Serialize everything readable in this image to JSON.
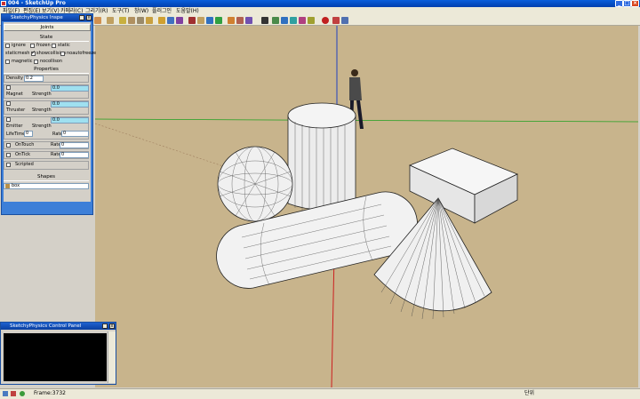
{
  "window": {
    "title": "004 - SketchUp Pro"
  },
  "menu": [
    "파일(F)",
    "편집(E)",
    "보기(V)",
    "카메라(C)",
    "그리기(R)",
    "도구(T)",
    "창(W)",
    "플러그인",
    "도움말(H)"
  ],
  "physics_panel": {
    "title": "SketchyPhysics Inspe",
    "joints_button": "Joints",
    "state_header": "State",
    "state_options": [
      {
        "label": "ignore",
        "checked": false
      },
      {
        "label": "frozen",
        "checked": false
      },
      {
        "label": "static",
        "checked": false
      },
      {
        "label": "staticmesh",
        "checked": false
      },
      {
        "label": "showcollision",
        "checked": true
      },
      {
        "label": "noautofreeze",
        "checked": false
      },
      {
        "label": "magnetic",
        "checked": false
      },
      {
        "label": "nocollison",
        "checked": false
      }
    ],
    "properties_header": "Properties",
    "density_label": "Density",
    "density_value": "0.2",
    "magnet_label": "Magnet",
    "magnet_strength_label": "Strength",
    "magnet_strength_value": "0.0",
    "thruster_label": "Thruster",
    "thruster_strength_label": "Strength",
    "thruster_strength_value": "0.0",
    "emitter_label": "Emitter",
    "emitter_strength_label": "Strength",
    "emitter_strength_value": "0.0",
    "lifetime_label": "LifeTime",
    "lifetime_value": "0",
    "rate_label": "Rate",
    "rate_value": "0",
    "ontouch_label": "OnTouch",
    "ontouch_rate_label": "Rate",
    "ontouch_rate_value": "0",
    "ontick_label": "OnTick",
    "ontick_rate_label": "Rate",
    "ontick_rate_value": "0",
    "scripted_label": "Scripted",
    "shapes_header": "Shapes",
    "shape_value": "box"
  },
  "control_panel": {
    "title": "SketchyPhysics Control Panel"
  },
  "status": {
    "frame": "Frame:3732",
    "units": "단위"
  },
  "colors": {
    "viewport": "#c8b48c",
    "title_blue": "#0a5fdc",
    "panel_blue": "#3d7fd8",
    "axis_red": "#cc2020",
    "axis_green": "#20a020",
    "axis_blue": "#2040c0"
  }
}
